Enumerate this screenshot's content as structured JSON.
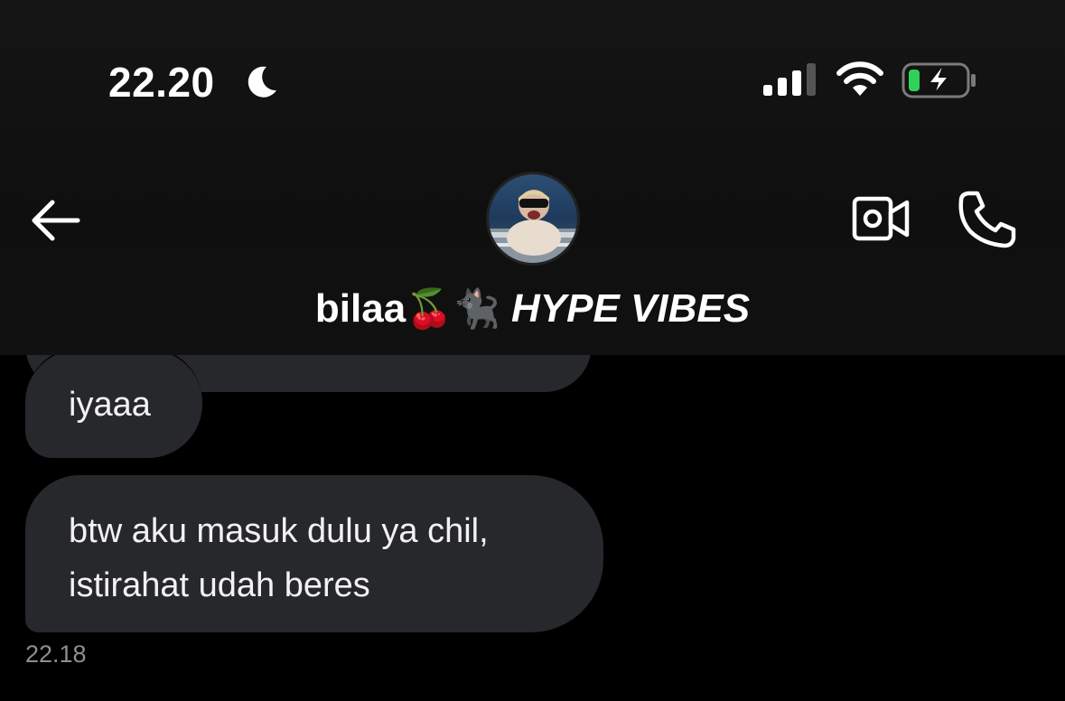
{
  "status_bar": {
    "time": "22.20",
    "moon_icon": "moon-icon",
    "signal_icon": "cellular-signal-icon",
    "wifi_icon": "wifi-icon",
    "battery_icon": "battery-charging-icon",
    "battery_color": "#30d158"
  },
  "header": {
    "back_icon": "back-arrow-icon",
    "contact_name": "bilaa",
    "contact_emojis": "🍒🐈‍⬛",
    "contact_tag": "HYPE VIBES",
    "video_call_icon": "video-call-icon",
    "voice_call_icon": "phone-icon"
  },
  "messages": [
    {
      "text": "iyaaa"
    },
    {
      "line1": "btw aku masuk dulu ya chil,",
      "line2": "istirahat udah beres"
    }
  ],
  "message_time": "22.18",
  "colors": {
    "background": "#000000",
    "bubble": "#27282b",
    "timestamp": "#8e8e93"
  }
}
